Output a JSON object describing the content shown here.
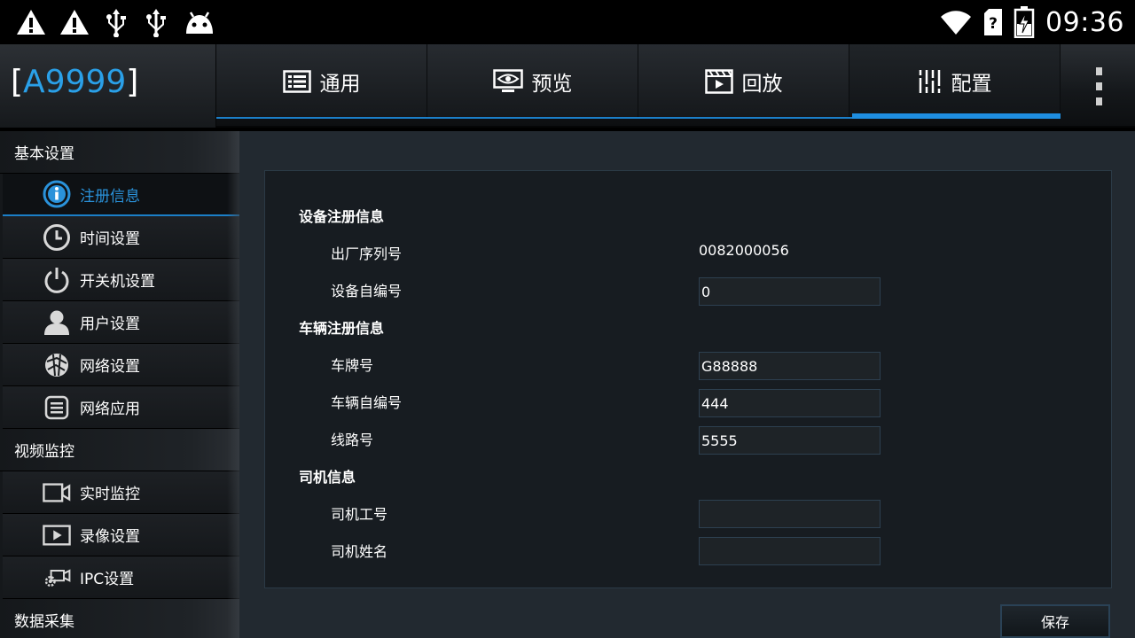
{
  "status_bar": {
    "icons": [
      "warning-icon",
      "warning-icon",
      "usb-icon",
      "usb-icon",
      "android-icon"
    ],
    "right_icons": [
      "wifi-icon",
      "sim-unknown-icon",
      "battery-charging-icon"
    ],
    "clock": "09:36"
  },
  "header": {
    "logo_open": "[",
    "logo_model": "A9999",
    "logo_close": "]",
    "tabs": [
      {
        "label": "通用",
        "icon": "list-icon"
      },
      {
        "label": "预览",
        "icon": "monitor-eye-icon"
      },
      {
        "label": "回放",
        "icon": "playback-icon"
      },
      {
        "label": "配置",
        "icon": "sliders-icon"
      }
    ],
    "active_tab": "配置",
    "more_icon": "more-vertical-icon"
  },
  "sidebar": {
    "groups": [
      {
        "label": "基本设置"
      },
      {
        "label": "视频监控"
      },
      {
        "label": "数据采集"
      }
    ],
    "items": [
      {
        "label": "注册信息",
        "icon": "info-icon"
      },
      {
        "label": "时间设置",
        "icon": "clock-icon"
      },
      {
        "label": "开关机设置",
        "icon": "power-icon"
      },
      {
        "label": "用户设置",
        "icon": "user-icon"
      },
      {
        "label": "网络设置",
        "icon": "network-globe-icon"
      },
      {
        "label": "网络应用",
        "icon": "network-app-icon"
      },
      {
        "label": "实时监控",
        "icon": "video-camera-icon"
      },
      {
        "label": "录像设置",
        "icon": "video-play-icon"
      },
      {
        "label": "IPC设置",
        "icon": "ipc-camera-icon"
      }
    ]
  },
  "form": {
    "sections": {
      "device": "设备注册信息",
      "vehicle": "车辆注册信息",
      "driver": "司机信息"
    },
    "fields": {
      "serial_label": "出厂序列号",
      "serial_value": "0082000056",
      "device_no_label": "设备自编号",
      "device_no_value": "0",
      "plate_label": "车牌号",
      "plate_value": "G88888",
      "vehicle_no_label": "车辆自编号",
      "vehicle_no_value": "444",
      "route_label": "线路号",
      "route_value": "5555",
      "driver_id_label": "司机工号",
      "driver_id_value": "",
      "driver_name_label": "司机姓名",
      "driver_name_value": ""
    },
    "save_label": "保存"
  },
  "colors": {
    "accent": "#1e8ee0",
    "logo_model": "#2aa0e8",
    "active_item_text": "#2a92da"
  }
}
